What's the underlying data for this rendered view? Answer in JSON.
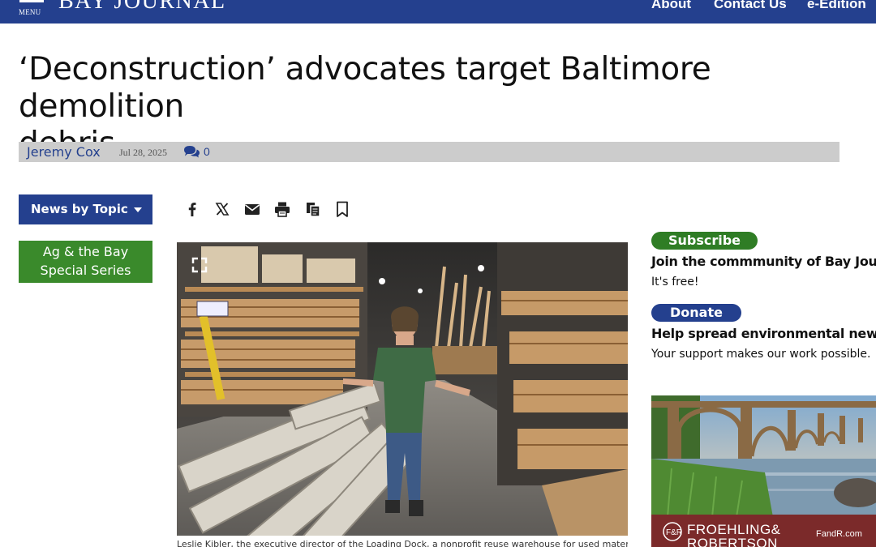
{
  "header": {
    "menu_label": "MENU",
    "logo_text": "BAY JOURNAL",
    "nav": [
      "About",
      "Contact Us",
      "e-Edition"
    ],
    "brand_color": "#24408e"
  },
  "article": {
    "headline_line1": "‘Deconstruction’ advocates target Baltimore demolition",
    "headline_line2": "debris",
    "author": "Jeremy Cox",
    "date": "Jul 28, 2025",
    "comment_count": "0",
    "caption": "Leslie Kibler, the executive director of the Loading Dock, a nonprofit reuse warehouse for used materials"
  },
  "left_nav": {
    "topic_label": "News by Topic",
    "special_line1": "Ag & the Bay",
    "special_line2": "Special Series"
  },
  "share_icons": [
    "facebook-icon",
    "x-icon",
    "email-icon",
    "print-icon",
    "copy-icon",
    "bookmark-icon"
  ],
  "sidebar": {
    "subscribe_label": "Subscribe",
    "subscribe_heading": "Join the commmunity of Bay Journal",
    "subscribe_sub": "It's free!",
    "donate_label": "Donate",
    "donate_heading": "Help spread environmental news.",
    "donate_sub": "Your support makes our work possible.",
    "ad_brand_line1": "FROEHLING&",
    "ad_brand_line2": "ROBERTSON",
    "ad_url": "FandR.com"
  }
}
